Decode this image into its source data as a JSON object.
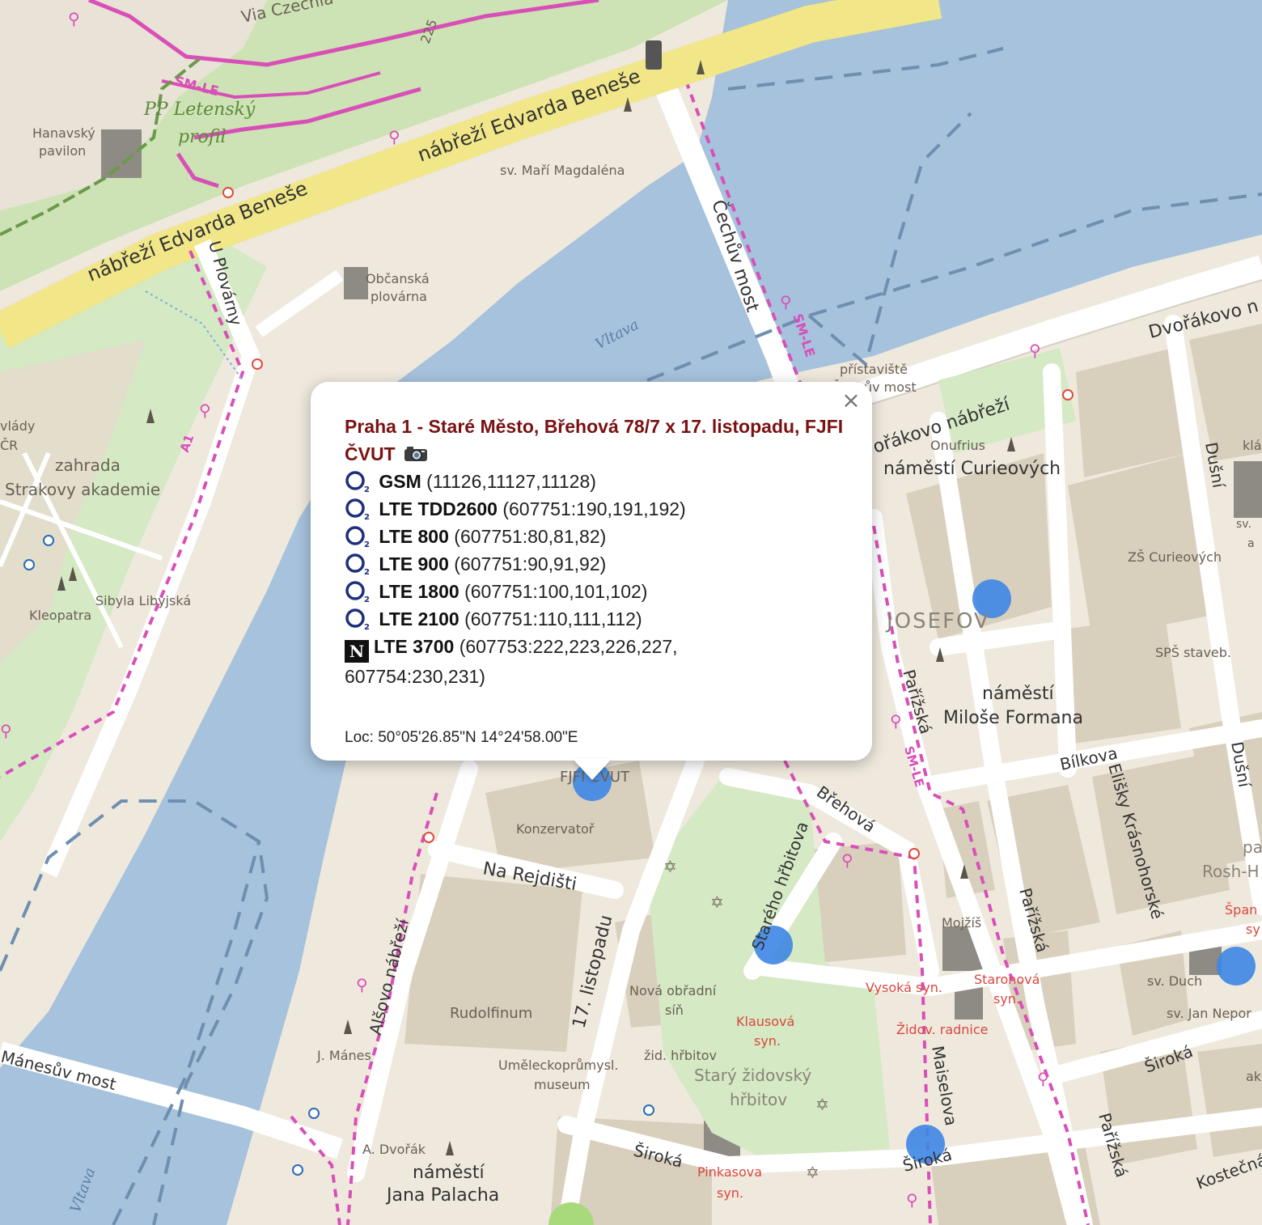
{
  "map": {
    "streets": {
      "via_czechia": "Via Czechia - středozem",
      "route_225": "225",
      "sm_le_1": "SM-LE",
      "pp_letensky": "PP Letenský",
      "profil": "profil",
      "nabrezi_benese_1": "nábřeží Edvarda Beneše",
      "nabrezi_benese_2": "nábřeží Edvarda Beneše",
      "u_plovarny": "U Plovárny",
      "cechuv_most": "Čechův most",
      "sm_le_2": "SM-LE",
      "dvorakovo_1": "Dvořákovo n",
      "dvorakovo_2": "ořákovo nábřeží",
      "dusni_1": "Dušní",
      "dusni_2": "Dušní",
      "parizska_1": "Pařížská",
      "parizska_2": "Pařížská",
      "parizska_3": "Pařížská",
      "sm_le_3": "SM-LE",
      "bilkova": "Bílkova",
      "elisky": "Elišky Krásnohorské",
      "brehova": "Břehová",
      "stareho_hrbitova": "Starého hřbitova",
      "na_rejdisti": "Na Rejdišti",
      "listopadu": "17. listopadu",
      "alsovo": "Alšovo nábřeží",
      "manesuv": "Mánesův most",
      "maiselova": "Maiselova",
      "siroka_1": "Široká",
      "siroka_2": "Široká",
      "siroka_3": "Široká",
      "kostecna": "Kostečná",
      "a1": "A1"
    },
    "places": {
      "hanavsky_1": "Hanavský",
      "hanavsky_2": "pavilon",
      "sv_mari": "sv. Maří Magdaléna",
      "obcanska_1": "Občanská",
      "obcanska_2": "plovárna",
      "vltava_1": "Vltava",
      "vltava_2": "Vltava",
      "pristaviste_1": "přístaviště",
      "pristaviste_2": "Čechův most",
      "vlady": "vlády",
      "cr": "ČR",
      "zahrada_1": "zahrada",
      "zahrada_2": "Strakovy akademie",
      "sibyla": "Sibyla Libyjská",
      "kleopatra": "Kleopatra",
      "onufrius": "Onufrius",
      "nam_curie": "náměstí Curieových",
      "zs_curie": "ZŠ Curieových",
      "josefov": "JOSEFOV",
      "sps": "SPŠ staveb.",
      "nam_formana_1": "náměstí",
      "nam_formana_2": "Miloše Formana",
      "kla": "klá",
      "sv_a": "sv.",
      "a_b": "a",
      "fjfi": "FJFI ČVUT",
      "konzervator": "Konzervatoř",
      "rudolfinum": "Rudolfinum",
      "nova_obradni_1": "Nová obřadní",
      "nova_obradni_2": "síň",
      "zid_hrbitov": "žid. hřbitov",
      "stary_zid_1": "Starý židovský",
      "stary_zid_2": "hřbitov",
      "klausova_1": "Klausová",
      "klausova_2": "syn.",
      "vysoka": "Vysoká syn.",
      "staronova_1": "Staronová",
      "staronova_2": "syn.",
      "zid_radnice": "Židov. radnice",
      "mojzis": "Mojžíš",
      "sv_duch": "sv. Duch",
      "sv_jan": "sv. Jan Nepor",
      "span_1": "Špan",
      "span_2": "sy",
      "pa": "pa",
      "rosh": "Rosh-H",
      "ak": "ak",
      "j_manes": "J. Mánes",
      "umeleckoprumysl_1": "Uměleckoprůmysl.",
      "umeleckoprumysl_2": "museum",
      "a_dvorak": "A. Dvořák",
      "nam_palacha_1": "náměstí",
      "nam_palacha_2": "Jana Palacha",
      "pinkasova_1": "Pinkasova",
      "pinkasova_2": "syn."
    },
    "colors": {
      "water": "#a6c2dc",
      "land": "#efe9dd",
      "park": "#d4e9c4",
      "building": "#d9cfbd",
      "road": "#ffffff",
      "highway": "#f7ee8e",
      "bike_route": "#d94fb8",
      "marker": "#3d86e6",
      "popup_title": "#7a1212"
    }
  },
  "popup": {
    "title": "Praha 1 - Staré Město, Břehová 78/7 x 17. listopadu, FJFI ČVUT",
    "camera_icon": "camera-icon",
    "rows": [
      {
        "operator": "O2",
        "tech": "GSM",
        "ids": "(11126,11127,11128)"
      },
      {
        "operator": "O2",
        "tech": "LTE TDD2600",
        "ids": "(607751:190,191,192)"
      },
      {
        "operator": "O2",
        "tech": "LTE 800",
        "ids": "(607751:80,81,82)"
      },
      {
        "operator": "O2",
        "tech": "LTE 900",
        "ids": "(607751:90,91,92)"
      },
      {
        "operator": "O2",
        "tech": "LTE 1800",
        "ids": "(607751:100,101,102)"
      },
      {
        "operator": "O2",
        "tech": "LTE 2100",
        "ids": "(607751:110,111,112)"
      }
    ],
    "nordic": {
      "operator": "N",
      "tech": "LTE 3700",
      "ids": "(607753:222,223,226,227,",
      "ids2": "607754:230,231)"
    },
    "loc": "Loc: 50°05'26.85\"N 14°24'58.00\"E",
    "close_label": "×"
  }
}
